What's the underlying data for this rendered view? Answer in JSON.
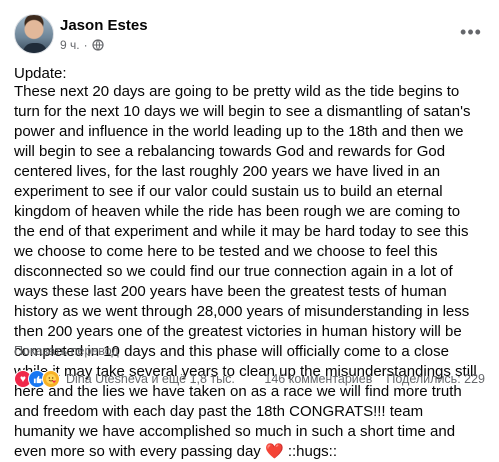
{
  "post": {
    "author": "Jason Estes",
    "time": "9 ч.",
    "separator": "·",
    "update_label": "Update:",
    "body_text": "These next 20 days are going to be pretty wild as the tide begins to turn for the next 10 days we will begin to see a dismantling of satan's power and influence in the world leading up to the 18th and then we will begin to see a rebalancing towards God and rewards for God centered lives, for the last roughly 200 years we have lived in an experiment to see if our valor could sustain us to build an eternal kingdom of heaven while the ride has been rough we are coming to the end of that experiment and while it may be hard today to see this we choose to come here to be tested and we choose to feel this disconnected so we could find our true connection again in a lot of ways these last 200 years have been the greatest tests of human history as we went through 28,000 years of misunderstanding in less then 200 years one of the greatest victories in human history will be completed in 10 days and this phase will officially come to a close while it may take several years to clean up the misunderstandings still here and the lies we have taken on as a race we will find more truth and freedom with each day past the 18th CONGRATS!!! team humanity we have accomplished so much in such a short time and even more so with every passing day",
    "heart_emoji": "❤️",
    "body_suffix": " ::hugs::",
    "translate_link": "Показать перевод"
  },
  "icons": {
    "privacy": "globe-icon",
    "menu": "more-dots-icon",
    "reactions": [
      "heart-reaction-icon",
      "like-reaction-icon",
      "care-reaction-icon"
    ]
  },
  "footer": {
    "reactions_text": "Dina Utesheva и ещё 1,8 тыс.",
    "comments": "146 комментариев",
    "shares": "Поделились: 229"
  },
  "colors": {
    "secondary_text": "#65676b",
    "like_blue": "#1877f2",
    "heart_red": "#f0284a",
    "care_yellow": "#f7b125"
  }
}
